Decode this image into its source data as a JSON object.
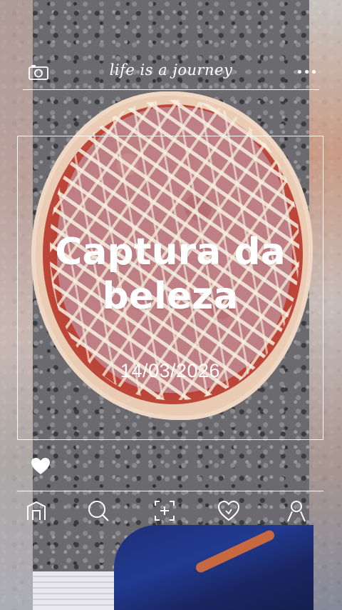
{
  "header": {
    "title": "life is a journey",
    "left_icon": "camera-icon",
    "right_icon": "more-icon"
  },
  "post": {
    "headline_line1": "Captura da",
    "headline_line2": "beleza",
    "date": "14/03/2026",
    "like_icon": "heart-icon"
  },
  "nav": {
    "items": [
      {
        "icon": "home-icon"
      },
      {
        "icon": "search-icon"
      },
      {
        "icon": "add-photo-icon"
      },
      {
        "icon": "likes-icon"
      },
      {
        "icon": "profile-icon"
      }
    ]
  },
  "colors": {
    "overlay_text": "#ffffff"
  }
}
